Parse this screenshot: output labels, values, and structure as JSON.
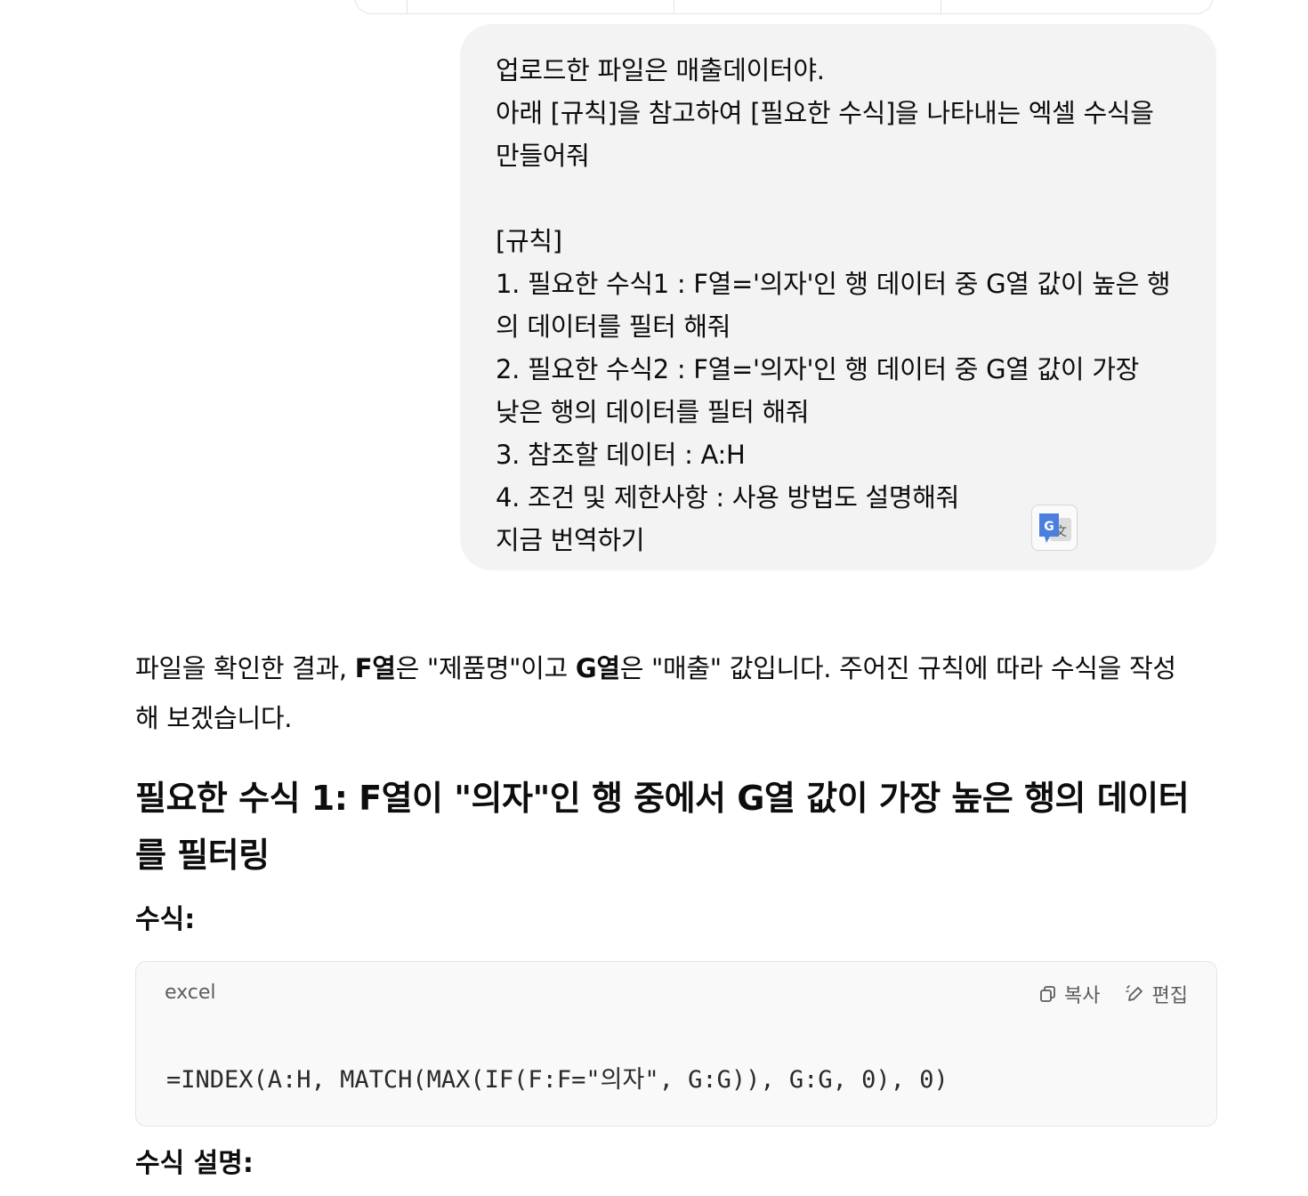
{
  "user_message": {
    "text": "업로드한 파일은 매출데이터야.\n아래 [규칙]을 참고하여 [필요한 수식]을 나타내는 엑셀 수식을\n만들어줘\n\n[규칙]\n1. 필요한 수식1 : F열='의자'인 행 데이터 중 G열 값이 높은 행\n의 데이터를 필터 해줘\n2. 필요한 수식2 : F열='의자'인 행 데이터 중 G열 값이 가장\n낮은 행의 데이터를 필터 해줘\n3. 참조할 데이터 : A:H\n4. 조건 및 제한사항 : 사용 방법도 설명해줘\n지금 번역하기",
    "translate_icon": "google-translate-icon"
  },
  "response": {
    "intro_pre": "파일을 확인한 결과, ",
    "intro_f": "F열",
    "intro_mid": "은 \"제품명\"이고 ",
    "intro_g": "G열",
    "intro_post": "은 \"매출\" 값입니다. 주어진 규칙에 따라 수식을 작성\n해 보겠습니다.",
    "heading1": "필요한 수식 1: F열이 \"의자\"인 행 중에서 G열 값이 가장 높은 행의 데이터를 필터링",
    "formula_label": "수식:",
    "explain_label": "수식 설명:"
  },
  "code_block": {
    "language": "excel",
    "copy_label": "복사",
    "edit_label": "편집",
    "code": "=INDEX(A:H, MATCH(MAX(IF(F:F=\"의자\", G:G)), G:G, 0), 0)"
  }
}
